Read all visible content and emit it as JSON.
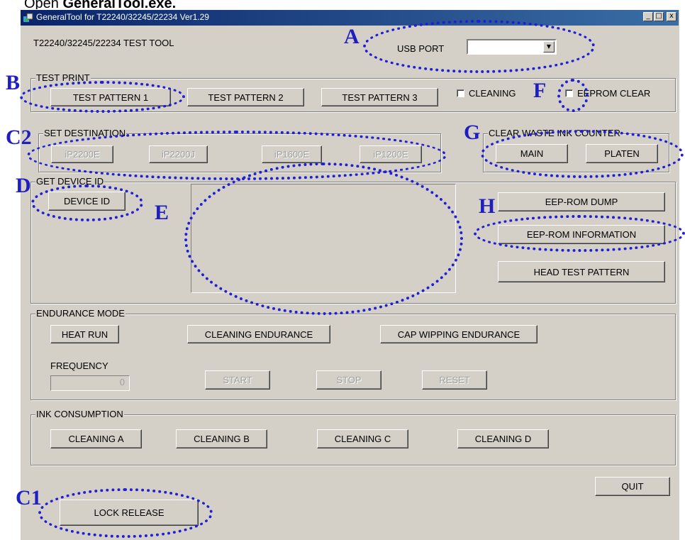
{
  "caption": {
    "text": "Open ",
    "bold": "GeneralTool.exe."
  },
  "window": {
    "title": "GeneralTool for T22240/32245/22234 Ver1.29",
    "controls": {
      "minimize": "_",
      "maximize": "□",
      "close": "x"
    }
  },
  "header": {
    "tool_name": "T22240/32245/22234 TEST TOOL",
    "usb_port_label": "USB PORT",
    "usb_port_value": ""
  },
  "test_print": {
    "title": "TEST PRINT",
    "buttons": [
      "TEST PATTERN 1",
      "TEST PATTERN 2",
      "TEST PATTERN 3"
    ],
    "cleaning_label": "CLEANING",
    "eeprom_clear_label": "EEPROM CLEAR"
  },
  "set_destination": {
    "title": "SET DESTINATION",
    "buttons": [
      "iP2200E",
      "iP2200J",
      "iP1600E",
      "iP1200E"
    ]
  },
  "clear_waste": {
    "title": "CLEAR WASTE INK COUNTER",
    "buttons": [
      "MAIN",
      "PLATEN"
    ]
  },
  "get_device_id": {
    "title": "GET DEVICE ID",
    "device_id_button": "DEVICE ID"
  },
  "eeprom": {
    "dump": "EEP-ROM DUMP",
    "information": "EEP-ROM INFORMATION",
    "head_test": "HEAD TEST PATTERN"
  },
  "endurance": {
    "title": "ENDURANCE MODE",
    "buttons": [
      "HEAT RUN",
      "CLEANING ENDURANCE",
      "CAP WIPPING ENDURANCE"
    ],
    "frequency_label": "FREQUENCY",
    "frequency_value": "0",
    "controls": [
      "START",
      "STOP",
      "RESET"
    ]
  },
  "ink_consumption": {
    "title": "INK CONSUMPTION",
    "buttons": [
      "CLEANING A",
      "CLEANING B",
      "CLEANING C",
      "CLEANING D"
    ]
  },
  "quit": "QUIT",
  "lock_release": "LOCK RELEASE",
  "annotations": [
    "A",
    "B",
    "C2",
    "D",
    "E",
    "F",
    "G",
    "H",
    "C1"
  ],
  "colors": {
    "annotation": "#1f1fbf",
    "titlebar": "#0a246a",
    "face": "#d4d0c8"
  }
}
